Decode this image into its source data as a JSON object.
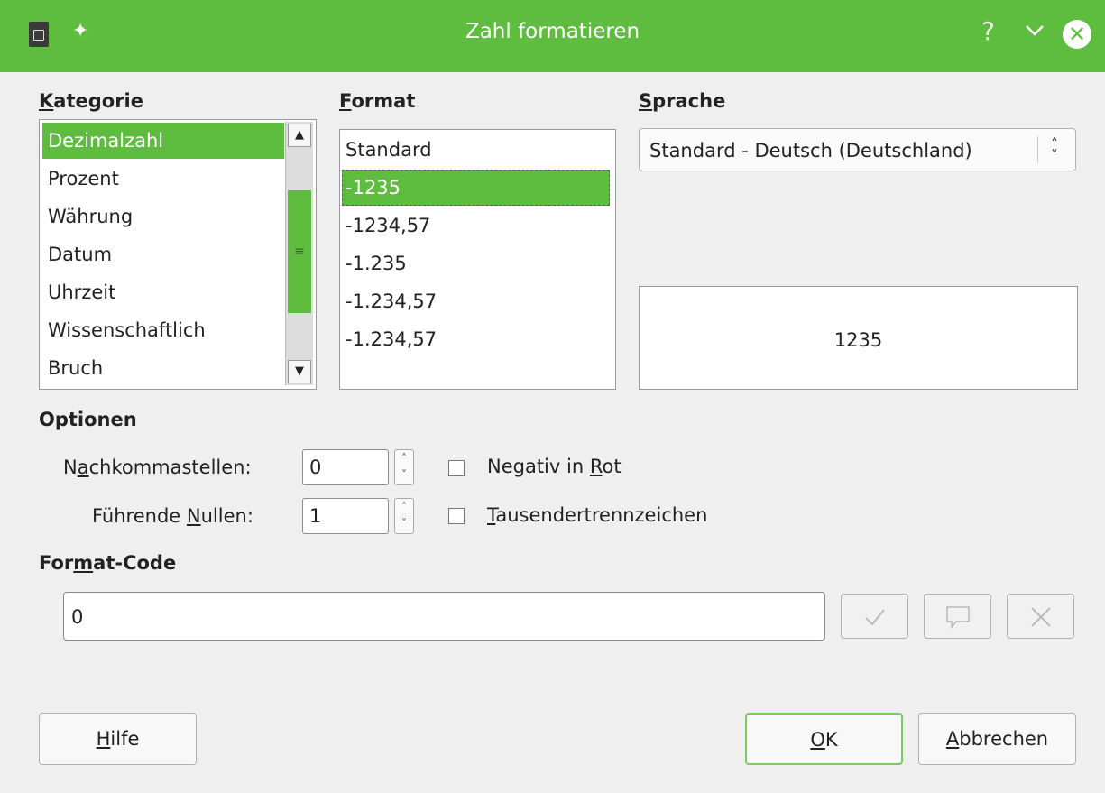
{
  "window": {
    "title": "Zahl formatieren",
    "help_glyph": "?",
    "close_glyph": "✕"
  },
  "kategorie": {
    "label_ul": "K",
    "label_rest": "ategorie",
    "items": [
      "Dezimalzahl",
      "Prozent",
      "Währung",
      "Datum",
      "Uhrzeit",
      "Wissenschaftlich",
      "Bruch"
    ],
    "selected": "Dezimalzahl"
  },
  "format": {
    "label_ul": "F",
    "label_rest": "ormat",
    "items": [
      "Standard",
      "-1235",
      "-1234,57",
      "-1.235",
      "-1.234,57",
      "-1.234,57"
    ],
    "selected": "-1235"
  },
  "sprache": {
    "label_ul": "S",
    "label_rest": "prache",
    "value": "Standard - Deutsch (Deutschland)"
  },
  "preview": {
    "value": "1235"
  },
  "optionen": {
    "label": "Optionen",
    "nachkomma_pre": "N",
    "nachkomma_ul": "a",
    "nachkomma_post": "chkommastellen:",
    "nachkomma_value": "0",
    "fuehrende_pre": "Führende ",
    "fuehrende_ul": "N",
    "fuehrende_post": "ullen:",
    "fuehrende_value": "1",
    "negativ_pre": "Negativ in ",
    "negativ_ul": "R",
    "negativ_post": "ot",
    "negativ_checked": false,
    "tausender_ul": "T",
    "tausender_post": "ausendertrennzeichen",
    "tausender_checked": false
  },
  "formatcode": {
    "label_pre": "For",
    "label_ul": "m",
    "label_post": "at-Code",
    "value": "0"
  },
  "buttons": {
    "hilfe_ul": "H",
    "hilfe_post": "ilfe",
    "ok_ul": "O",
    "ok_post": "K",
    "abbrechen_ul": "A",
    "abbrechen_post": "bbrechen"
  },
  "colors": {
    "accent": "#5ebd3e",
    "background": "#efefef"
  },
  "icons": [
    "app-icon",
    "pin-icon",
    "help-icon",
    "chevron-down-icon",
    "close-icon",
    "checkmark-icon",
    "comment-icon",
    "x-icon"
  ]
}
